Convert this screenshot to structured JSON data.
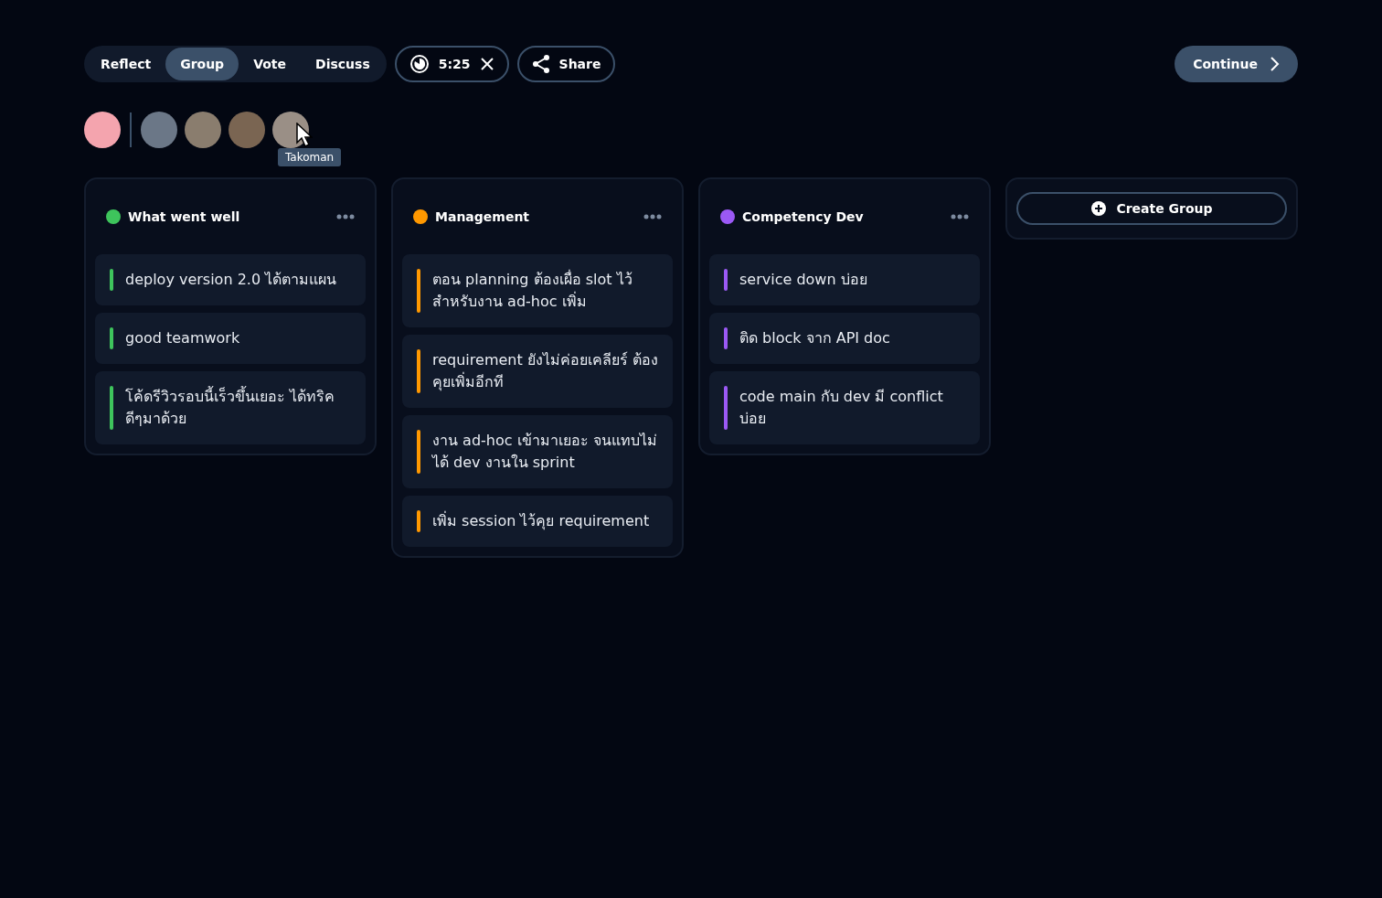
{
  "phases": [
    {
      "label": "Reflect",
      "selected": false
    },
    {
      "label": "Group",
      "selected": true
    },
    {
      "label": "Vote",
      "selected": false
    },
    {
      "label": "Discuss",
      "selected": false
    }
  ],
  "timer": {
    "value": "5:25"
  },
  "share_button": {
    "label": "Share"
  },
  "continue_button": {
    "label": "Continue"
  },
  "avatars": [
    {
      "self": true
    },
    {
      "self": false
    },
    {
      "self": false
    },
    {
      "self": false
    },
    {
      "self": false,
      "tooltip": "Takoman"
    }
  ],
  "groups": [
    {
      "title": "What went well",
      "color": "#3ec45c",
      "cards": [
        "deploy version 2.0 ได้ตามแผน",
        "good teamwork",
        "โค้ดรีวิวรอบนี้เร็วขึ้นเยอะ ได้ทริคดีๆมาด้วย"
      ]
    },
    {
      "title": "Management",
      "color": "#ff9800",
      "cards": [
        "ตอน planning ต้องเผื่อ slot ไว้สำหรับงาน ad-hoc เพิ่ม",
        "requirement ยังไม่ค่อยเคลียร์ ต้องคุยเพิ่มอีกที",
        "งาน ad-hoc เข้ามาเยอะ จนแทบไม่ได้ dev งานใน sprint",
        "เพิ่ม session ไว้คุย requirement"
      ]
    },
    {
      "title": "Competency Dev",
      "color": "#9b59f5",
      "cards": [
        "service down บ่อย",
        "ติด block จาก API doc",
        "code main กับ dev มี conflict บ่อย"
      ]
    }
  ],
  "create_group_button": {
    "label": "Create Group"
  }
}
